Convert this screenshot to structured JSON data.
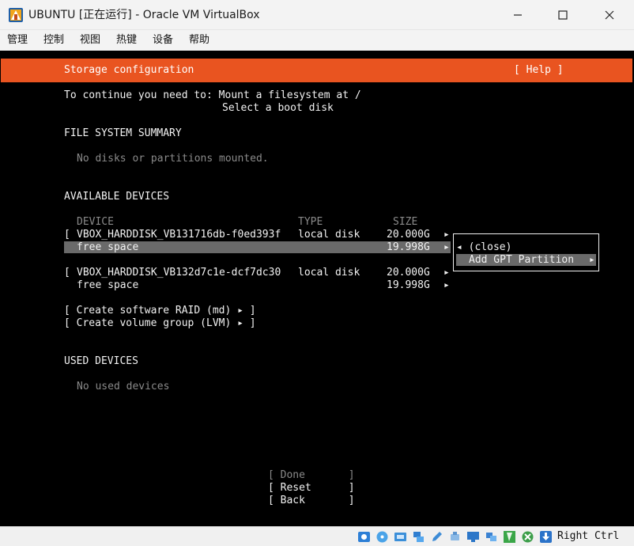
{
  "window": {
    "title": "UBUNTU [正在运行] - Oracle VM VirtualBox",
    "controls": [
      "minimize",
      "maximize",
      "close"
    ]
  },
  "menu": [
    "管理",
    "控制",
    "视图",
    "热键",
    "设备",
    "帮助"
  ],
  "console": {
    "header_title": "Storage configuration",
    "header_help": "[ Help ]",
    "instructions_line1": "To continue you need to: Mount a filesystem at /",
    "instructions_line2": "Select a boot disk",
    "fs_summary_heading": "FILE SYSTEM SUMMARY",
    "fs_summary_empty": "No disks or partitions mounted.",
    "available_heading": "AVAILABLE DEVICES",
    "columns": {
      "device": "DEVICE",
      "type": "TYPE",
      "size": "SIZE"
    },
    "devices": [
      {
        "bracket": "[",
        "name": "VBOX_HARDDISK_VB131716db-f0ed393f",
        "type": "local disk",
        "size": "20.000G",
        "arrow": "▸",
        "free_label": "free space",
        "free_size": "19.998G",
        "free_arrow": "▸"
      },
      {
        "bracket": "[",
        "name": "VBOX_HARDDISK_VB132d7c1e-dcf7dc30",
        "type": "local disk",
        "size": "20.000G",
        "arrow": "▸",
        "free_label": "free space",
        "free_size": "19.998G",
        "free_arrow": "▸"
      }
    ],
    "create_raid": "[ Create software RAID (md) ▸ ]",
    "create_lvm": "[ Create volume group (LVM) ▸ ]",
    "used_heading": "USED DEVICES",
    "used_empty": "No used devices",
    "popup": {
      "close_label": "◂ (close)",
      "add_gpt_label": "Add GPT Partition",
      "add_gpt_arrow": "▸"
    },
    "buttons": {
      "done": "[ Done       ]",
      "reset": "[ Reset      ]",
      "back": "[ Back       ]"
    }
  },
  "statusbar": {
    "icons": [
      "optical-drive-icon",
      "disc-icon",
      "audio-icon",
      "network-icon",
      "pencil-icon",
      "usb-icon",
      "display-icon",
      "shared-folders-icon",
      "recording-icon",
      "mouse-integration-icon",
      "down-arrow-icon"
    ],
    "host_key": "Right Ctrl"
  },
  "colors": {
    "accent": "#e95420",
    "console_bg": "#000000",
    "selection": "#6a6a6a"
  }
}
